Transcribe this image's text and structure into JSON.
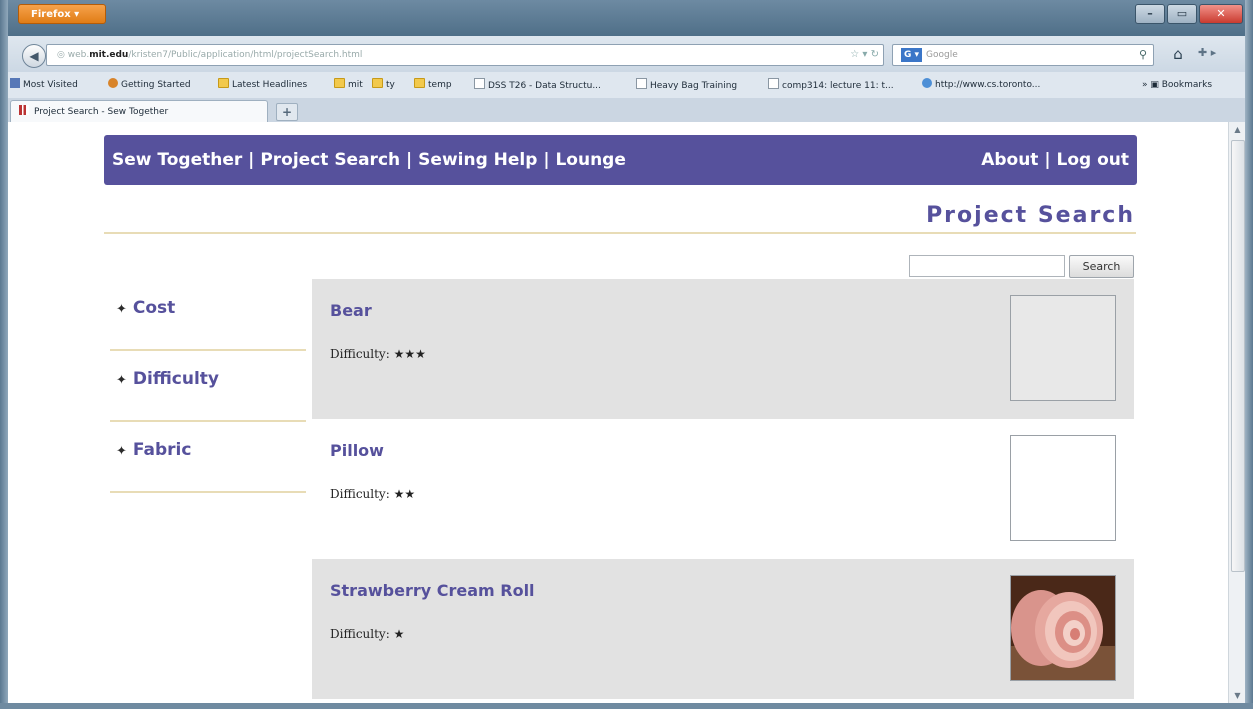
{
  "browser": {
    "menu_button": "Firefox",
    "url_host": "web.mit.edu",
    "url_path": "/kristen7/Public/application/html/projectSearch.html",
    "url_prefix": "web.",
    "search_engine": "Google",
    "bookmarks": [
      {
        "label": "Most Visited",
        "icon": "mv"
      },
      {
        "label": "Getting Started",
        "icon": "gs"
      },
      {
        "label": "Latest Headlines",
        "icon": "folder"
      },
      {
        "label": "mit",
        "icon": "folder"
      },
      {
        "label": "ty",
        "icon": "folder"
      },
      {
        "label": "temp",
        "icon": "folder"
      },
      {
        "label": "DSS T26 - Data Structu...",
        "icon": "page"
      },
      {
        "label": "Heavy Bag Training",
        "icon": "page"
      },
      {
        "label": "comp314: lecture 11: t...",
        "icon": "page"
      },
      {
        "label": "http://www.cs.toronto...",
        "icon": "globe"
      }
    ],
    "bookmarks_menu": "Bookmarks",
    "tab_title": "Project Search - Sew Together",
    "new_tab": "+"
  },
  "site": {
    "nav_left": [
      "Sew Together",
      "Project Search",
      "Sewing Help",
      "Lounge"
    ],
    "nav_right": [
      "About",
      "Log out"
    ],
    "separator": " | ",
    "page_title": "Project Search",
    "search_button": "Search",
    "search_value": ""
  },
  "filters": [
    {
      "label": "Cost"
    },
    {
      "label": "Difficulty"
    },
    {
      "label": "Fabric"
    }
  ],
  "projects": [
    {
      "name": "Bear",
      "difficulty_label": "Difficulty:",
      "stars": 3,
      "thumbnail": "empty",
      "style": "shaded"
    },
    {
      "name": "Pillow",
      "difficulty_label": "Difficulty:",
      "stars": 2,
      "thumbnail": "empty",
      "style": "plain"
    },
    {
      "name": "Strawberry Cream Roll",
      "difficulty_label": "Difficulty:",
      "stars": 1,
      "thumbnail": "cake-roll-photo",
      "style": "shaded"
    }
  ],
  "colors": {
    "accent": "#56519c",
    "rule": "#e8dcb6",
    "shaded_row": "#e2e2e2"
  }
}
